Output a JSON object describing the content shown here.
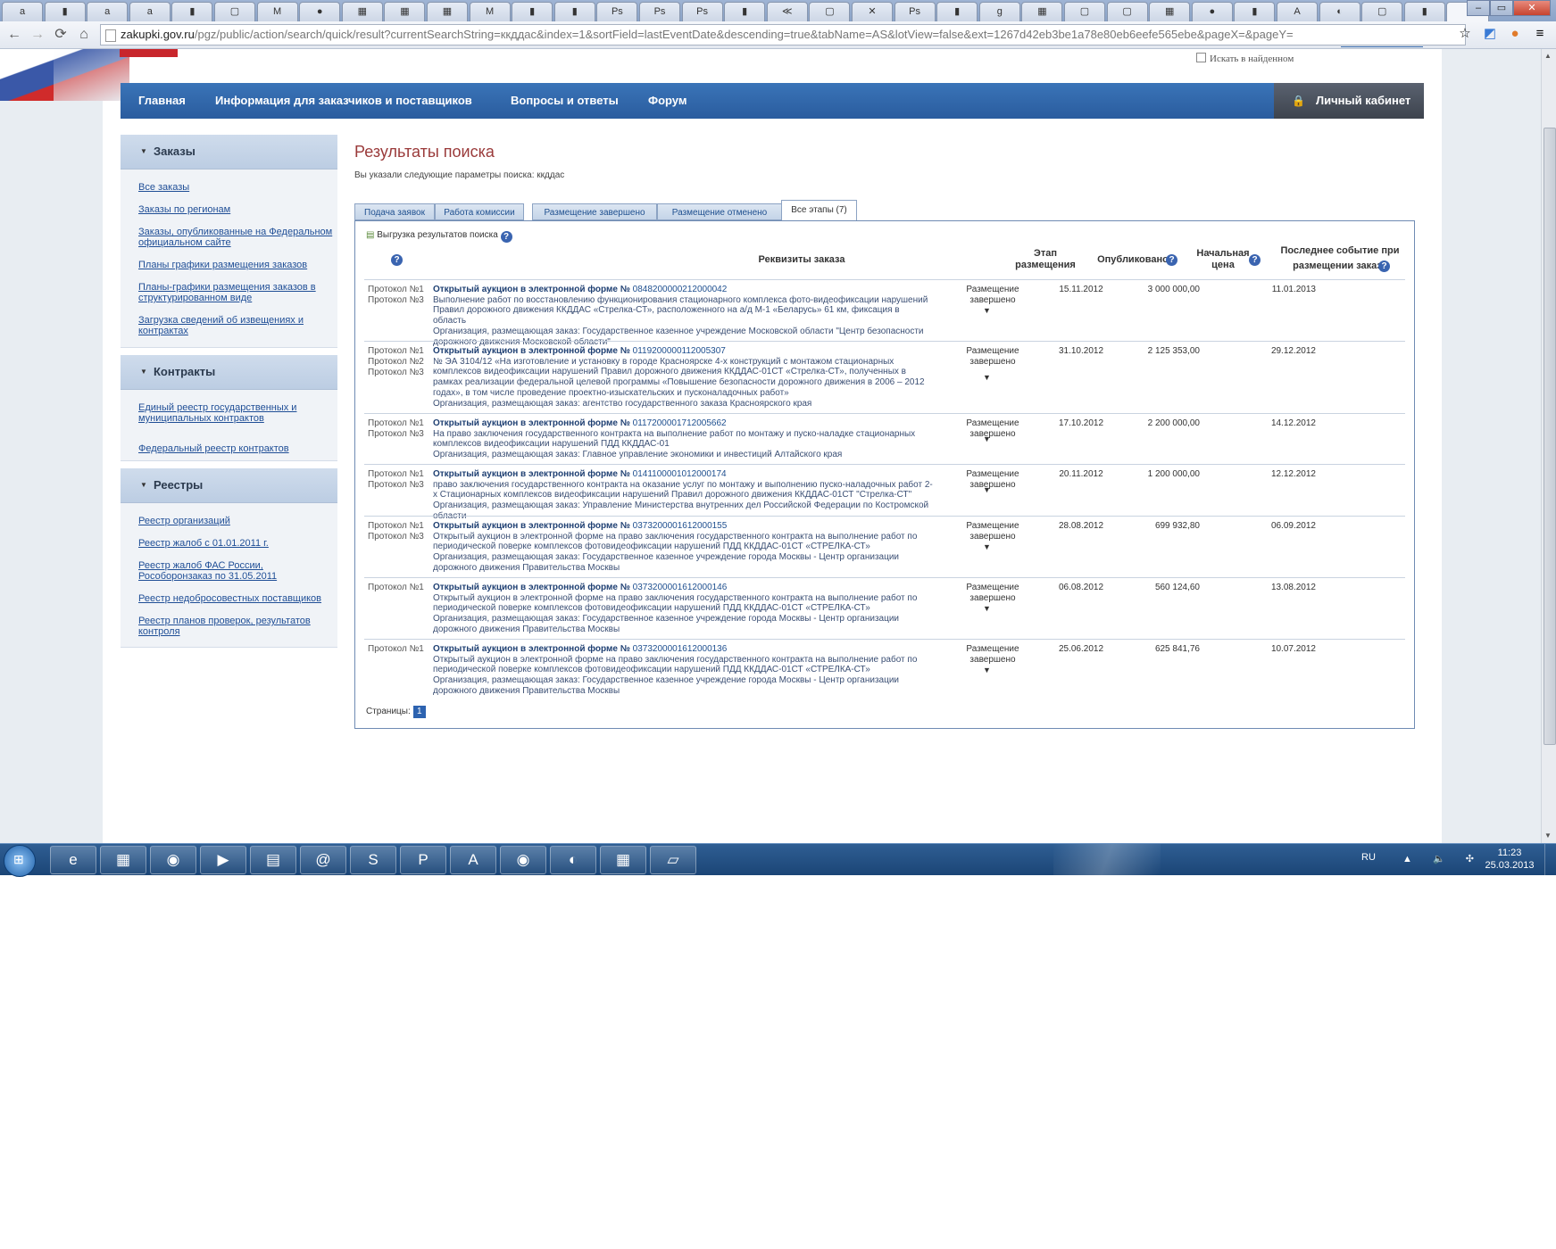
{
  "browser": {
    "tabs": [
      "a",
      "▮",
      "a",
      "a",
      "▮",
      "▢",
      "M",
      "●",
      "▦",
      "▦",
      "▦",
      "M",
      "▮",
      "▮",
      "Ps",
      "Ps",
      "Ps",
      "▮",
      "≪",
      "▢",
      "✕",
      "Ps",
      "▮",
      "g",
      "▦",
      "▢",
      "▢",
      "▦",
      "●",
      "▮",
      "A",
      "◐",
      "▢",
      "▮"
    ],
    "active_tab_close": "×",
    "url_host": "zakupki.gov.ru",
    "url_path": "/pgz/public/action/search/quick/result?currentSearchString=ккддас&index=1&sortField=lastEventDate&descending=true&tabName=AS&lotView=false&ext=1267d42eb3be1a78e80eb6eefe565ebe&pageX=&pageY=",
    "win_min": "–",
    "win_max": "▭",
    "win_close": "✕"
  },
  "header": {
    "search_in_found": "Искать в найденном"
  },
  "menu": {
    "home": "Главная",
    "info": "Информация для заказчиков и поставщиков",
    "faq": "Вопросы и ответы",
    "forum": "Форум",
    "cabinet": "Личный кабинет"
  },
  "sidebar": {
    "orders": {
      "title": "Заказы",
      "links": [
        "Все заказы",
        "Заказы по регионам",
        "Заказы, опубликованные на Федеральном официальном сайте",
        "Планы графики размещения заказов",
        "Планы-графики размещения заказов в структурированном виде",
        "Загрузка сведений об извещениях и контрактах"
      ]
    },
    "contracts": {
      "title": "Контракты",
      "links": [
        "Единый реестр государственных и муниципальных контрактов",
        "Федеральный реестр контрактов"
      ]
    },
    "registries": {
      "title": "Реестры",
      "links": [
        "Реестр организаций",
        "Реестр жалоб с 01.01.2011 г.",
        "Реестр жалоб ФАС России, Рособоронзаказ по 31.05.2011",
        "Реестр недобросовестных поставщиков",
        "Реестр планов проверок, результатов контроля"
      ]
    }
  },
  "content": {
    "title": "Результаты поиска",
    "params": "Вы указали следующие параметры поиска: ккддас",
    "tabs": [
      "Подача заявок",
      "Работа комиссии",
      "Размещение завершено",
      "Размещение отменено",
      "Все этапы (7)"
    ],
    "export": "Выгрузка результатов поиска",
    "columns": {
      "details": "Реквизиты заказа",
      "stage": "Этап размещения",
      "published": "Опубликовано",
      "price": "Начальная цена",
      "last_event": "Последнее событие при размещении заказа"
    },
    "pages_label": "Страницы:",
    "current_page": "1",
    "rows": [
      {
        "protocols": [
          "Протокол №1",
          "Протокол №3"
        ],
        "lot_label": "Открытый аукцион в электронной форме №",
        "lot_no": "0848200000212000042",
        "text": "Выполнение работ по восстановлению функционирования стационарного комплекса фото-видеофиксации нарушений Правил дорожного движения ККДДАС «Стрелка-СТ», расположенного на а/д М-1 «Беларусь» 61 км, фиксация в область",
        "org": "Организация, размещающая заказ: Государственное казенное учреждение Московской области \"Центр безопасности дорожного движения Московской области\"",
        "stage": "Размещение завершено",
        "published": "15.11.2012",
        "price": "3 000 000,00",
        "event": "11.01.2013"
      },
      {
        "protocols": [
          "Протокол №1",
          "Протокол №2",
          "Протокол №3"
        ],
        "lot_label": "Открытый аукцион в электронной форме №",
        "lot_no": "0119200000112005307",
        "text": "№ ЭА 3104/12 «На изготовление и установку в городе Красноярске 4-х конструкций с монтажом стационарных комплексов видеофиксации нарушений Правил дорожного движения ККДДАС-01СТ «Стрелка-СТ», полученных в рамках реализации федеральной целевой программы «Повышение безопасности дорожного движения в 2006 – 2012 годах», в том числе проведение проектно-изыскательских и пусконаладочных работ»",
        "org": "Организация, размещающая заказ: агентство государственного заказа Красноярского края",
        "stage": "Размещение завершено",
        "published": "31.10.2012",
        "price": "2 125 353,00",
        "event": "29.12.2012"
      },
      {
        "protocols": [
          "Протокол №1",
          "Протокол №3"
        ],
        "lot_label": "Открытый аукцион в электронной форме №",
        "lot_no": "0117200001712005662",
        "text": "На право заключения государственного контракта на выполнение работ по монтажу и пуско-наладке стационарных комплексов видеофиксации нарушений ПДД ККДДАС-01",
        "org": "Организация, размещающая заказ: Главное управление экономики и инвестиций Алтайского края",
        "stage": "Размещение завершено",
        "published": "17.10.2012",
        "price": "2 200 000,00",
        "event": "14.12.2012"
      },
      {
        "protocols": [
          "Протокол №1",
          "Протокол №3"
        ],
        "lot_label": "Открытый аукцион в электронной форме №",
        "lot_no": "0141100001012000174",
        "text": "право заключения государственного контракта на оказание услуг по монтажу и выполнению пуско-наладочных работ 2-х Стационарных комплексов видеофиксации нарушений Правил дорожного движения ККДДАС-01СТ \"Стрелка-СТ\"",
        "org": "Организация, размещающая заказ: Управление Министерства внутренних дел Российской Федерации по Костромской области",
        "stage": "Размещение завершено",
        "published": "20.11.2012",
        "price": "1 200 000,00",
        "event": "12.12.2012"
      },
      {
        "protocols": [
          "Протокол №1",
          "Протокол №3"
        ],
        "lot_label": "Открытый аукцион в электронной форме №",
        "lot_no": "0373200001612000155",
        "text": "Открытый аукцион в электронной форме на право заключения государственного контракта на выполнение работ по периодической поверке комплексов фотовидеофиксации нарушений ПДД ККДДАС-01СТ «СТРЕЛКА-СТ»",
        "org": "Организация, размещающая заказ: Государственное казенное учреждение города Москвы - Центр организации дорожного движения Правительства Москвы",
        "stage": "Размещение завершено",
        "published": "28.08.2012",
        "price": "699 932,80",
        "event": "06.09.2012"
      },
      {
        "protocols": [
          "Протокол №1"
        ],
        "lot_label": "Открытый аукцион в электронной форме №",
        "lot_no": "0373200001612000146",
        "text": "Открытый аукцион в электронной форме на право заключения государственного контракта на выполнение работ по периодической поверке комплексов фотовидеофиксации нарушений ПДД ККДДАС-01СТ «СТРЕЛКА-СТ»",
        "org": "Организация, размещающая заказ: Государственное казенное учреждение города Москвы - Центр организации дорожного движения Правительства Москвы",
        "stage": "Размещение завершено",
        "published": "06.08.2012",
        "price": "560 124,60",
        "event": "13.08.2012"
      },
      {
        "protocols": [
          "Протокол №1"
        ],
        "lot_label": "Открытый аукцион в электронной форме №",
        "lot_no": "0373200001612000136",
        "text": "Открытый аукцион в электронной форме на право заключения государственного контракта на выполнение работ по периодической поверке комплексов фотовидеофиксации нарушений ПДД ККДДАС-01СТ «СТРЕЛКА-СТ»",
        "org": "Организация, размещающая заказ: Государственное казенное учреждение города Москвы - Центр организации дорожного движения Правительства Москвы",
        "stage": "Размещение завершено",
        "published": "25.06.2012",
        "price": "625 841,76",
        "event": "10.07.2012"
      }
    ]
  },
  "taskbar": {
    "apps": [
      "e",
      "▦",
      "◉",
      "▶",
      "▤",
      "@",
      "S",
      "P",
      "A",
      "◉",
      "◐",
      "▦",
      "▱"
    ],
    "lang": "RU",
    "tray_icons": "▲ 🔈 ✣",
    "time": "11:23",
    "date": "25.03.2013"
  }
}
